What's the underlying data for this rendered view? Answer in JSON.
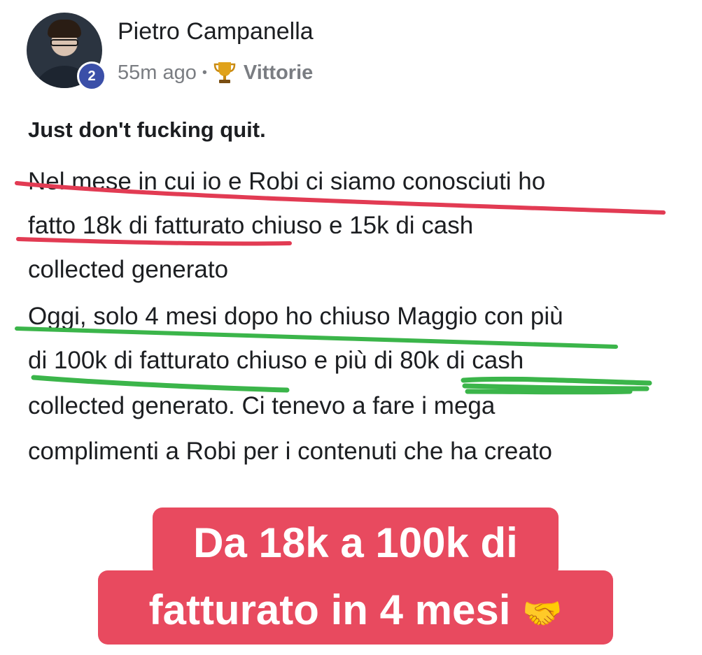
{
  "post": {
    "author": "Pietro Campanella",
    "badge_count": "2",
    "time_ago": "55m ago",
    "separator": "•",
    "category_icon": "trophy-icon",
    "category": "Vittorie",
    "title": "Just don't fucking quit.",
    "body_lines": [
      "Nel mese in cui io e Robi ci siamo conosciuti ho",
      "fatto 18k di fatturato chiuso e 15k di cash",
      "collected generato",
      "Oggi, solo 4 mesi dopo ho chiuso Maggio con più",
      "di 100k di fatturato chiuso e più di 80k di cash",
      "collected generato. Ci tenevo a fare i mega",
      "complimenti a Robi per i contenuti che ha creato"
    ]
  },
  "overlay": {
    "line1": "Da 18k a 100k di",
    "line2": "fatturato in 4 mesi",
    "emoji": "🤝",
    "background": "#e84a5f"
  },
  "colors": {
    "red_underline": "#e23b53",
    "green_underline": "#3bb54a",
    "badge": "#3b4fa8"
  }
}
